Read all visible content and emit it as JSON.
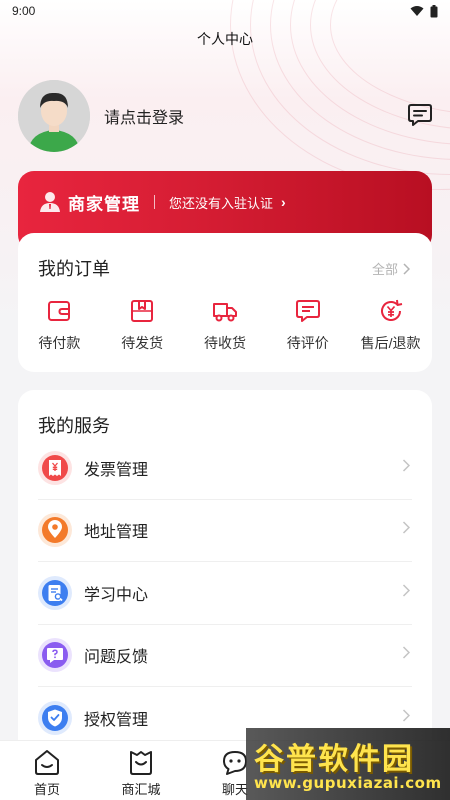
{
  "status_bar": {
    "time": "9:00"
  },
  "header": {
    "title": "个人中心"
  },
  "profile": {
    "login_prompt": "请点击登录"
  },
  "merchant": {
    "title": "商家管理",
    "subtitle": "您还没有入驻认证",
    "arrow": "›"
  },
  "orders": {
    "title": "我的订单",
    "all_label": "全部",
    "items": [
      {
        "label": "待付款",
        "icon": "wallet-icon"
      },
      {
        "label": "待发货",
        "icon": "package-icon"
      },
      {
        "label": "待收货",
        "icon": "truck-icon"
      },
      {
        "label": "待评价",
        "icon": "review-icon"
      },
      {
        "label": "售后/退款",
        "icon": "refund-icon"
      }
    ]
  },
  "services": {
    "title": "我的服务",
    "items": [
      {
        "label": "发票管理",
        "icon": "invoice-icon",
        "color": "#f04a4a"
      },
      {
        "label": "地址管理",
        "icon": "location-icon",
        "color": "#f37a2a"
      },
      {
        "label": "学习中心",
        "icon": "study-icon",
        "color": "#3d7ef0"
      },
      {
        "label": "问题反馈",
        "icon": "feedback-icon",
        "color": "#8a5cf0"
      },
      {
        "label": "授权管理",
        "icon": "shield-icon",
        "color": "#3d7ef0"
      }
    ]
  },
  "tabbar": {
    "items": [
      {
        "label": "首页",
        "icon": "home-icon"
      },
      {
        "label": "商汇城",
        "icon": "shopping-bag-icon"
      },
      {
        "label": "聊天",
        "icon": "chat-icon"
      }
    ]
  },
  "watermark": {
    "title": "谷普软件园",
    "url": "www.gupuxiazai.com"
  },
  "colors": {
    "accent": "#e8253e",
    "accent_dark": "#b80f22",
    "background": "#f4f4f6"
  }
}
